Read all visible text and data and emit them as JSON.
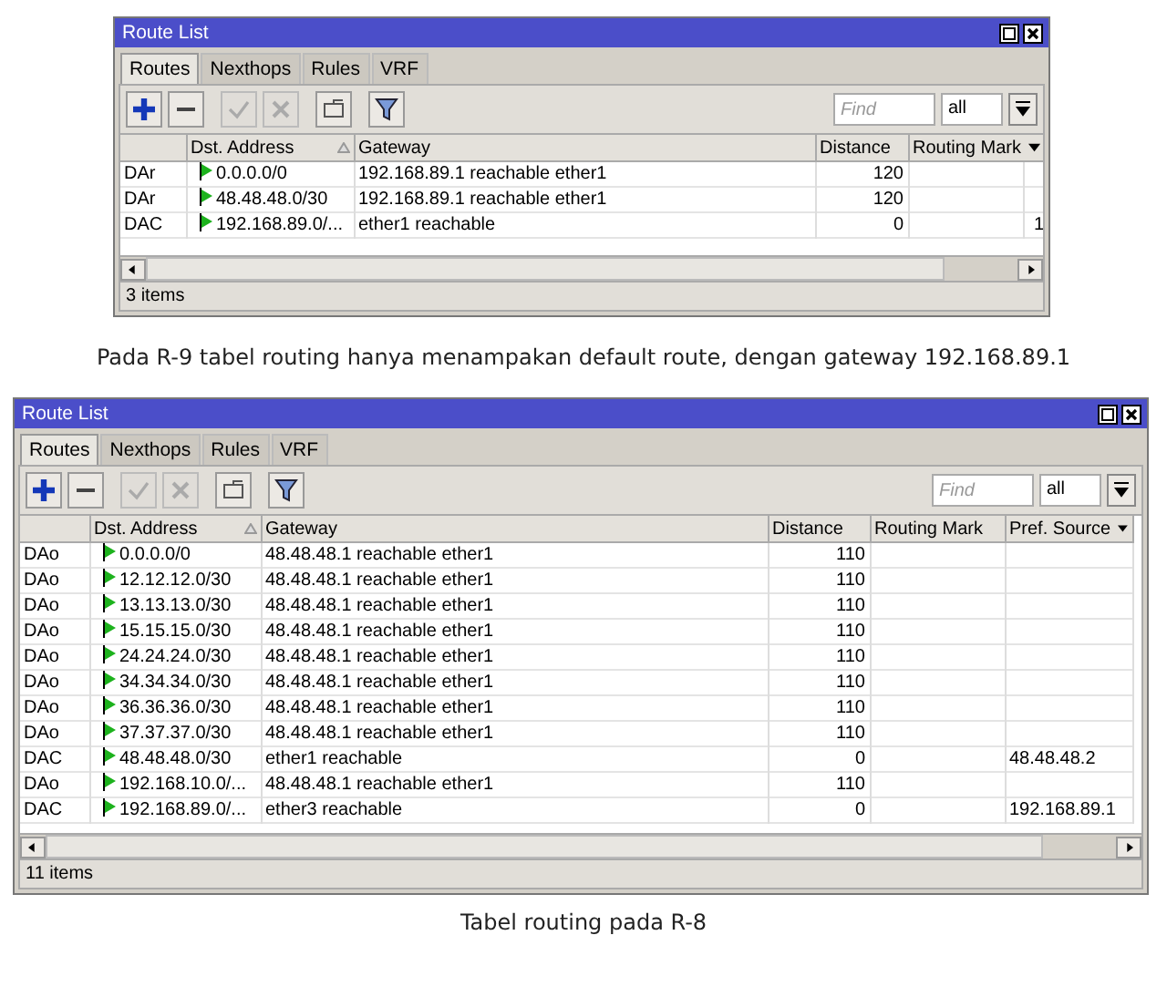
{
  "figures": [
    {
      "window": {
        "title": "Route List"
      },
      "tabs": [
        {
          "label": "Routes",
          "selected": true
        },
        {
          "label": "Nexthops",
          "selected": false
        },
        {
          "label": "Rules",
          "selected": false
        },
        {
          "label": "VRF",
          "selected": false
        }
      ],
      "toolbar": [
        {
          "kind": "add",
          "disabled": false
        },
        {
          "kind": "remove",
          "disabled": false
        },
        {
          "kind": "enable",
          "disabled": true
        },
        {
          "kind": "disable",
          "disabled": true
        },
        {
          "kind": "comment",
          "disabled": false
        },
        {
          "kind": "filter",
          "disabled": false
        }
      ],
      "search": {
        "placeholder": "Find"
      },
      "filter_select": "all",
      "table": {
        "columns": [
          "Dst. Address",
          "Gateway",
          "Distance",
          "Routing Mark"
        ],
        "rows": [
          {
            "flags": "DAr",
            "dst_address": "0.0.0.0/0",
            "gateway": "192.168.89.1 reachable ether1",
            "distance": "120"
          },
          {
            "flags": "DAr",
            "dst_address": "48.48.48.0/30",
            "gateway": "192.168.89.1 reachable ether1",
            "distance": "120"
          },
          {
            "flags": "DAC",
            "dst_address": "192.168.89.0/...",
            "gateway": "ether1 reachable",
            "distance": "0",
            "column_6": "1"
          }
        ]
      },
      "status_bar": "3 items",
      "caption": "Pada R-9 tabel routing hanya menampakan default route, dengan gateway 192.168.89.1"
    },
    {
      "window": {
        "title": "Route List"
      },
      "tabs": [
        {
          "label": "Routes",
          "selected": true
        },
        {
          "label": "Nexthops",
          "selected": false
        },
        {
          "label": "Rules",
          "selected": false
        },
        {
          "label": "VRF",
          "selected": false
        }
      ],
      "toolbar": [
        {
          "kind": "add",
          "disabled": false
        },
        {
          "kind": "remove",
          "disabled": false
        },
        {
          "kind": "enable",
          "disabled": true
        },
        {
          "kind": "disable",
          "disabled": true
        },
        {
          "kind": "comment",
          "disabled": false
        },
        {
          "kind": "filter",
          "disabled": false
        }
      ],
      "search": {
        "placeholder": "Find"
      },
      "filter_select": "all",
      "table": {
        "columns": [
          "Dst. Address",
          "Gateway",
          "Distance",
          "Routing Mark",
          "Pref. Source"
        ],
        "rows": [
          {
            "flags": "DAo",
            "dst_address": "0.0.0.0/0",
            "gateway": "48.48.48.1 reachable ether1",
            "distance": "110"
          },
          {
            "flags": "DAo",
            "dst_address": "12.12.12.0/30",
            "gateway": "48.48.48.1 reachable ether1",
            "distance": "110"
          },
          {
            "flags": "DAo",
            "dst_address": "13.13.13.0/30",
            "gateway": "48.48.48.1 reachable ether1",
            "distance": "110"
          },
          {
            "flags": "DAo",
            "dst_address": "15.15.15.0/30",
            "gateway": "48.48.48.1 reachable ether1",
            "distance": "110"
          },
          {
            "flags": "DAo",
            "dst_address": "24.24.24.0/30",
            "gateway": "48.48.48.1 reachable ether1",
            "distance": "110"
          },
          {
            "flags": "DAo",
            "dst_address": "34.34.34.0/30",
            "gateway": "48.48.48.1 reachable ether1",
            "distance": "110"
          },
          {
            "flags": "DAo",
            "dst_address": "36.36.36.0/30",
            "gateway": "48.48.48.1 reachable ether1",
            "distance": "110"
          },
          {
            "flags": "DAo",
            "dst_address": "37.37.37.0/30",
            "gateway": "48.48.48.1 reachable ether1",
            "distance": "110"
          },
          {
            "flags": "DAC",
            "dst_address": "48.48.48.0/30",
            "gateway": "ether1 reachable",
            "distance": "0",
            "pref_source": "48.48.48.2"
          },
          {
            "flags": "DAo",
            "dst_address": "192.168.10.0/...",
            "gateway": "48.48.48.1 reachable ether1",
            "distance": "110"
          },
          {
            "flags": "DAC",
            "dst_address": "192.168.89.0/...",
            "gateway": "ether3 reachable",
            "distance": "0",
            "pref_source": "192.168.89.1"
          }
        ]
      },
      "status_bar": "11 items",
      "caption": "Tabel routing pada R-8"
    }
  ]
}
